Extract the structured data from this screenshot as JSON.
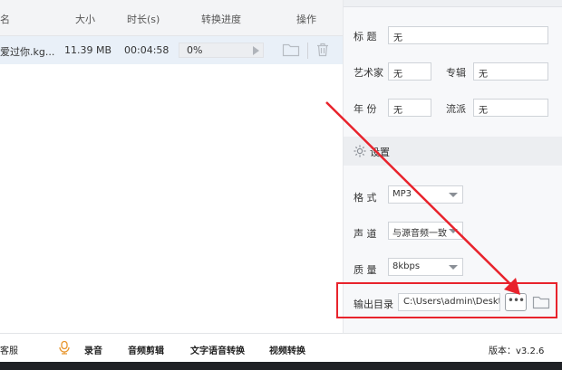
{
  "table": {
    "headers": {
      "name": "名",
      "size": "大小",
      "duration": "时长(s)",
      "progress": "转换进度",
      "actions": "操作"
    },
    "row": {
      "name": "爱过你.kg...",
      "size": "11.39 MB",
      "duration": "00:04:58",
      "progress": "0%",
      "progress_value": 0
    }
  },
  "metadata": {
    "title_label": "标  题",
    "title_value": "无",
    "artist_label": "艺术家",
    "artist_value": "无",
    "album_label": "专辑",
    "album_value": "无",
    "year_label": "年  份",
    "year_value": "无",
    "genre_label": "流派",
    "genre_value": "无"
  },
  "settings": {
    "section_title": "设置",
    "format_label": "格  式",
    "format_value": "MP3",
    "channel_label": "声  道",
    "channel_value": "与源音频一致",
    "quality_label": "质  量",
    "quality_value": "8kbps",
    "output_label": "输出目录",
    "output_value": "C:\\Users\\admin\\Desktop",
    "browse_label": "•••"
  },
  "toolbar": {
    "customer_service": "客服",
    "record": "录音",
    "audio_cut": "音频剪辑",
    "tts": "文字语音转换",
    "video_convert": "视频转换",
    "version": "版本：v3.2.6"
  },
  "colors": {
    "accent_red": "#e8232c",
    "row_selected": "#e9f0f8",
    "toolbar_icon": "#e8962e"
  }
}
